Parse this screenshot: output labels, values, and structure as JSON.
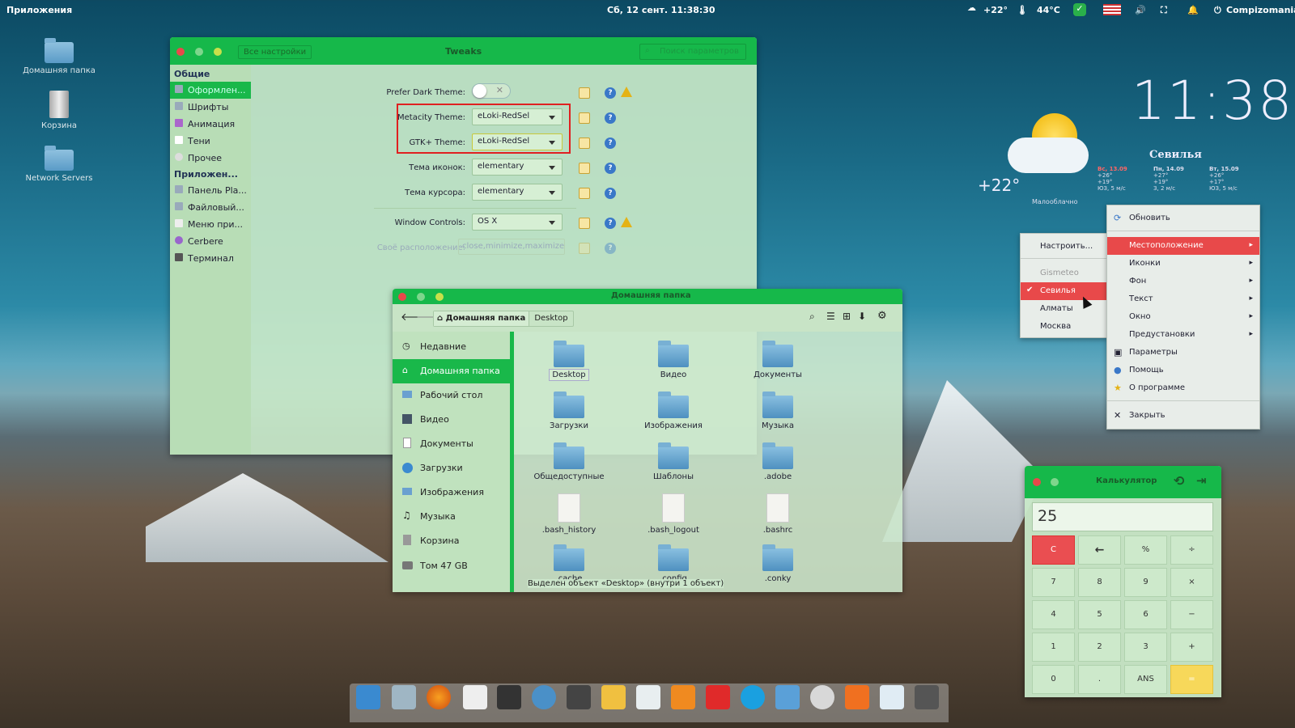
{
  "topbar": {
    "apps": "Приложения",
    "datetime": "Сб, 12 сент. 11:38:30",
    "weather_temp": "+22°",
    "cpu_temp": "44°C",
    "user": "Compizomania"
  },
  "desktop": {
    "icons": [
      {
        "label": "Домашняя папка"
      },
      {
        "label": "Корзина"
      },
      {
        "label": "Network Servers"
      }
    ]
  },
  "widget": {
    "clock": "11:38",
    "city": "Севилья",
    "temp": "+22°",
    "condition": "Малооблачно",
    "forecast": [
      {
        "day": "Вс, 13.09",
        "hi": "+26°",
        "lo": "+19°",
        "wind": "ЮЗ, 5 м/с"
      },
      {
        "day": "Пн, 14.09",
        "hi": "+27°",
        "lo": "+19°",
        "wind": "З, 2 м/с"
      },
      {
        "day": "Вт, 15.09",
        "hi": "+26°",
        "lo": "+17°",
        "wind": "ЮЗ, 5 м/с"
      }
    ]
  },
  "tweaks": {
    "title": "Tweaks",
    "back_button": "Все настройки",
    "search_placeholder": "Поиск параметров",
    "sidebar": {
      "section1": "Общие",
      "items1": [
        "Оформлен...",
        "Шрифты",
        "Анимация",
        "Тени",
        "Прочее"
      ],
      "section2": "Приложен...",
      "items2": [
        "Панель Pla...",
        "Файловый...",
        "Меню при...",
        "Cerbere",
        "Терминал"
      ]
    },
    "rows": [
      {
        "label": "Prefer Dark Theme:",
        "value": ""
      },
      {
        "label": "Metacity Theme:",
        "value": "eLoki-RedSel"
      },
      {
        "label": "GTK+ Theme:",
        "value": "eLoki-RedSel"
      },
      {
        "label": "Тема иконок:",
        "value": "elementary"
      },
      {
        "label": "Тема курсора:",
        "value": "elementary"
      },
      {
        "label": "Window Controls:",
        "value": "OS X"
      },
      {
        "label": "Своё расположение:",
        "value": "close,minimize,maximize"
      }
    ]
  },
  "files": {
    "title": "Домашняя папка",
    "crumb_home": "Домашняя папка",
    "crumb_desktop": "Desktop",
    "sidebar": [
      "Недавние",
      "Домашняя папка",
      "Рабочий стол",
      "Видео",
      "Документы",
      "Загрузки",
      "Изображения",
      "Музыка",
      "Корзина",
      "Том 47 GB"
    ],
    "items": [
      "Desktop",
      "Видео",
      "Документы",
      "Загрузки",
      "Изображения",
      "Музыка",
      "Общедоступные",
      "Шаблоны",
      ".adobe",
      ".bash_history",
      ".bash_logout",
      ".bashrc",
      ".cache",
      ".config",
      ".conky"
    ],
    "status": "Выделен объект «Desktop» (внутри 1 объект)"
  },
  "ctx_sub": {
    "items": [
      "Настроить...",
      "Gismeteo",
      "Севилья",
      "Алматы",
      "Москва"
    ]
  },
  "ctx_main": {
    "items": [
      "Обновить",
      "Местоположение",
      "Иконки",
      "Фон",
      "Текст",
      "Окно",
      "Предустановки",
      "Параметры",
      "Помощь",
      "О программе",
      "Закрыть"
    ]
  },
  "calc": {
    "title": "Калькулятор",
    "display": "25",
    "buttons": [
      "C",
      "←",
      "%",
      "÷",
      "7",
      "8",
      "9",
      "×",
      "4",
      "5",
      "6",
      "−",
      "1",
      "2",
      "3",
      "+",
      "0",
      ".",
      "ANS",
      "="
    ]
  }
}
